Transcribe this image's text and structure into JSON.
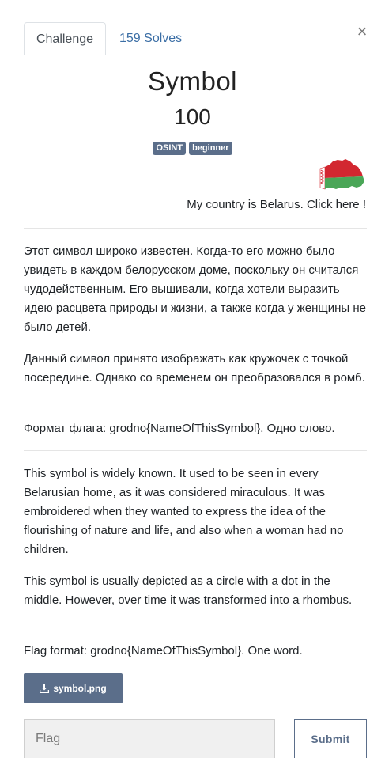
{
  "tabs": {
    "challenge_label": "Challenge",
    "solves_label": "159 Solves"
  },
  "close_label": "×",
  "challenge": {
    "name": "Symbol",
    "value": "100",
    "tags": [
      "OSINT",
      "beginner"
    ]
  },
  "flag_image_icon": "belarus-map-flag",
  "belarus_link_text": "My country is Belarus. Click here !",
  "description_ru": [
    "Этот символ широко известен. Когда-то его можно было увидеть в каждом белорусском доме, поскольку он считался чудодейственным. Его вышивали, когда хотели выразить идею расцвета природы и жизни, а также когда у женщины не было детей.",
    "Данный символ принято изображать как кружочек с точкой посередине. Однако со временем он преобразовался в ромб.",
    "Формат флага: grodno{NameOfThisSymbol}. Одно слово."
  ],
  "description_en": [
    "This symbol is widely known. It used to be seen in every Belarusian home, as it was considered miraculous. It was embroidered when they wanted to express the idea of the flourishing of nature and life, and also when a woman had no children.",
    "This symbol is usually depicted as a circle with a dot in the middle. However, over time it was transformed into a rhombus.",
    "Flag format: grodno{NameOfThisSymbol}. One word."
  ],
  "download": {
    "icon": "download-icon",
    "label": "symbol.png"
  },
  "flag_form": {
    "placeholder": "Flag",
    "submit_label": "Submit"
  },
  "colors": {
    "accent": "#5b6e8a",
    "link": "#3b6ea5",
    "belarus_red": "#d22730",
    "belarus_green": "#4aa657"
  }
}
